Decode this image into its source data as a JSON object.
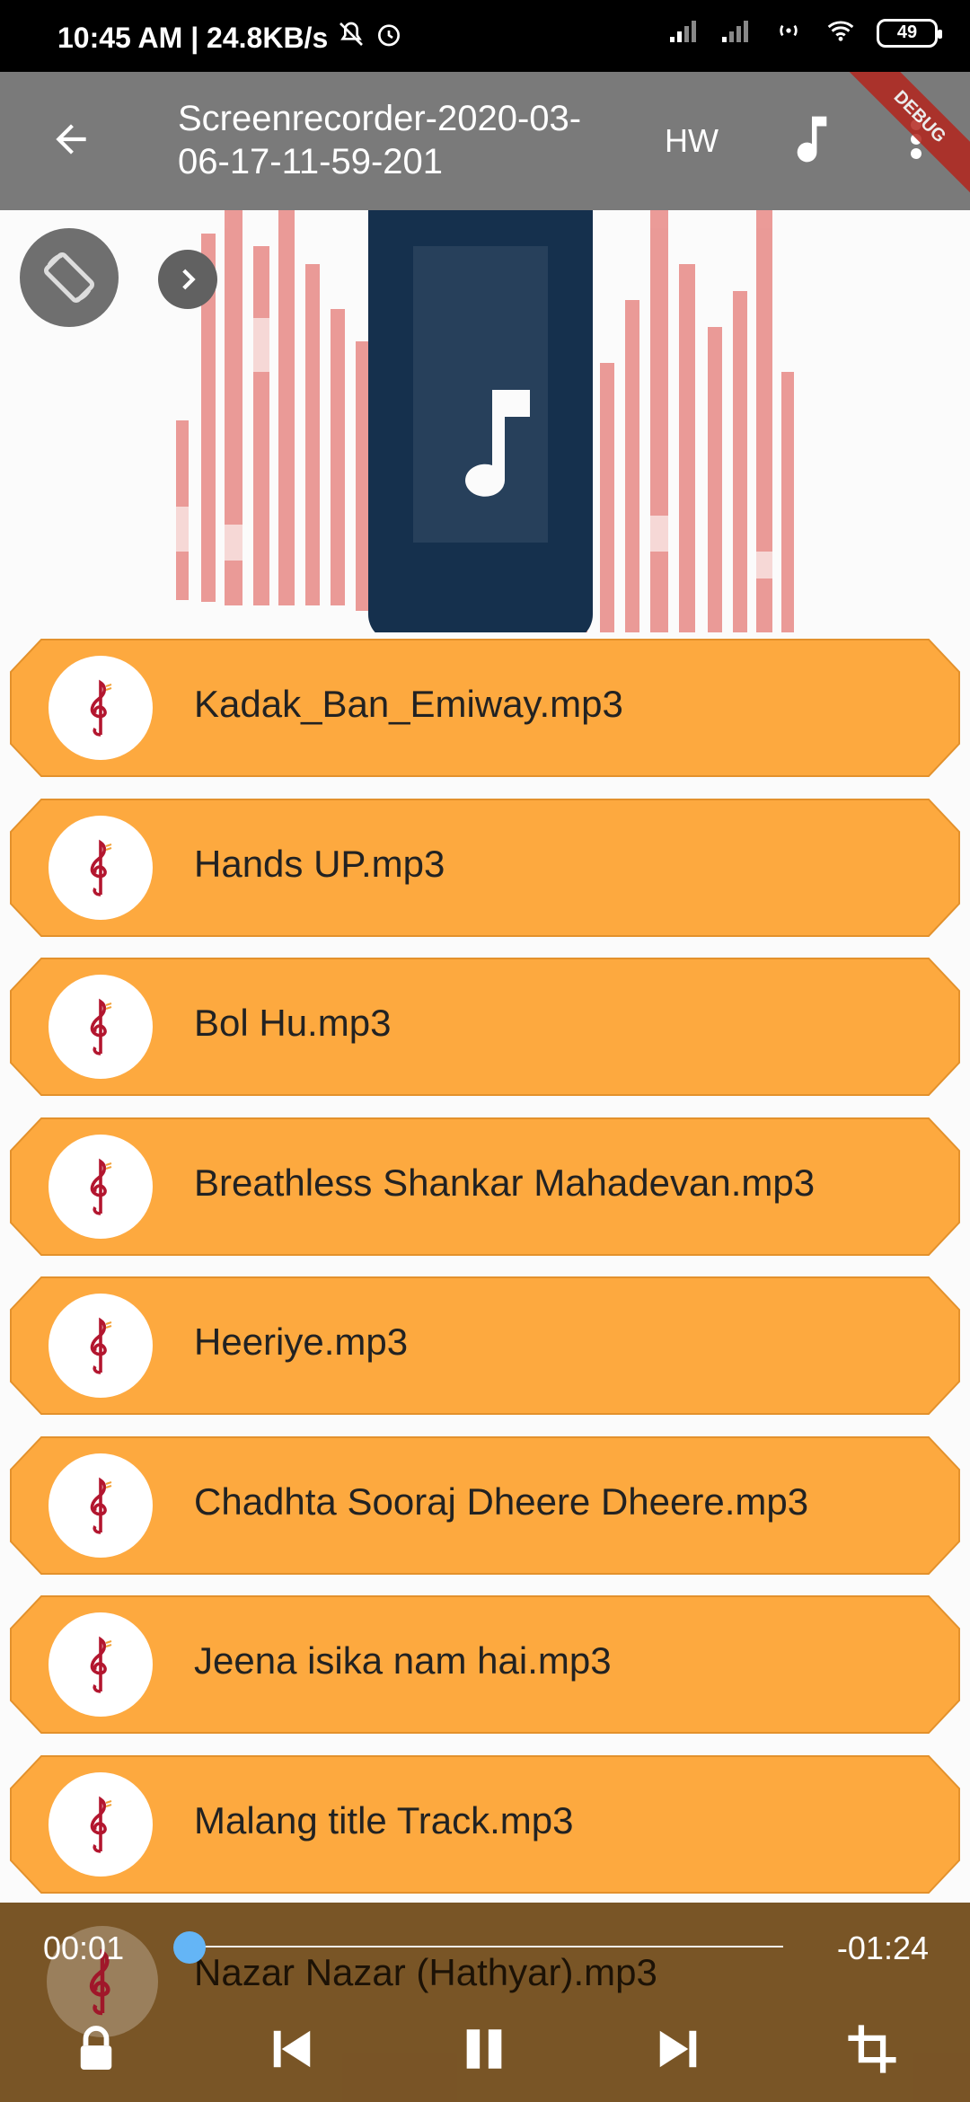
{
  "status_bar": {
    "time_speed": "10:45 AM | 24.8KB/s",
    "battery": "49"
  },
  "app_bar": {
    "title": "Screenrecorder-2020-03-06-17-11-59-201",
    "hw_label": "HW",
    "debug_banner": "DEBUG"
  },
  "songs": [
    {
      "label": "Kadak_Ban_Emiway.mp3"
    },
    {
      "label": "Hands UP.mp3"
    },
    {
      "label": "Bol Hu.mp3"
    },
    {
      "label": "Breathless Shankar Mahadevan.mp3"
    },
    {
      "label": "Heeriye.mp3"
    },
    {
      "label": "Chadhta Sooraj Dheere Dheere.mp3"
    },
    {
      "label": "Jeena isika nam hai.mp3"
    },
    {
      "label": "Malang title Track.mp3"
    }
  ],
  "player": {
    "elapsed": "00:01",
    "remaining": "-01:24",
    "partial_song_label": "Nazar Nazar (Hathyar).mp3",
    "progress_fraction": 0.01
  },
  "colors": {
    "tile": "#fda93f",
    "app_bar": "#7a7a7a",
    "hero_phone": "#15304d",
    "hero_bars": "#e88a86",
    "seek_knob": "#64b5f6"
  },
  "icons": {
    "back": "arrow-left-icon",
    "music": "music-note-icon",
    "more": "more-vert-icon",
    "rotate": "screen-rotation-icon",
    "chevron": "chevron-right-icon",
    "song": "treble-clef-icon",
    "lock": "lock-icon",
    "previous": "skip-previous-icon",
    "pause": "pause-icon",
    "next": "skip-next-icon",
    "crop": "crop-icon"
  }
}
